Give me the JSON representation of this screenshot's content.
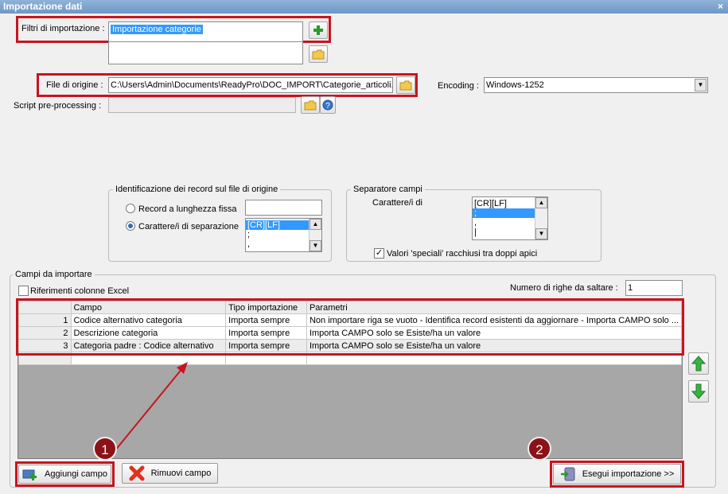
{
  "window": {
    "title": "Importazione dati",
    "close_glyph": "×"
  },
  "filters": {
    "label": "Filtri di importazione :",
    "selected": "Importazione categorie"
  },
  "source": {
    "label": "File di origine :",
    "value": "C:\\Users\\Admin\\Documents\\ReadyPro\\DOC_IMPORT\\Categorie_articoli.t"
  },
  "encoding": {
    "label": "Encoding :",
    "value": "Windows-1252"
  },
  "script": {
    "label": "Script pre-processing :"
  },
  "record_id": {
    "title": "Identificazione dei record sul file di origine",
    "opt_fixed": "Record a lunghezza fissa",
    "opt_sep": "Carattere/i di separazione",
    "list": [
      "[CR][LF]",
      ";",
      ","
    ]
  },
  "field_sep": {
    "title": "Separatore campi",
    "label": "Carattere/i di",
    "list": [
      "[CR][LF]",
      ";",
      ",",
      "|"
    ],
    "quotes_label": "Valori 'speciali' racchiusi tra doppi apici"
  },
  "fields": {
    "title": "Campi da importare",
    "excel_label": "Riferimenti colonne Excel",
    "skip_label": "Numero di righe da saltare :",
    "skip_value": "1",
    "columns": [
      "Campo",
      "Tipo importazione",
      "Parametri"
    ],
    "rows": [
      {
        "n": "1",
        "campo": "Codice alternativo categoria",
        "tipo": "Importa sempre",
        "param": "Non importare riga se vuoto - Identifica record esistenti da aggiornare - Importa CAMPO solo ..."
      },
      {
        "n": "2",
        "campo": "Descrizione categoria",
        "tipo": "Importa sempre",
        "param": "Importa CAMPO solo se Esiste/ha un valore"
      },
      {
        "n": "3",
        "campo": "Categoria padre : Codice alternativo",
        "tipo": "Importa sempre",
        "param": "Importa CAMPO solo se Esiste/ha un valore"
      }
    ]
  },
  "buttons": {
    "add": "Aggiungi campo",
    "remove": "Rimuovi campo",
    "run": "Esegui importazione >>"
  },
  "annotations": {
    "one": "1",
    "two": "2"
  },
  "colors": {
    "highlight": "#c8141e",
    "selection": "#3399ff",
    "badge": "#8b1218"
  }
}
